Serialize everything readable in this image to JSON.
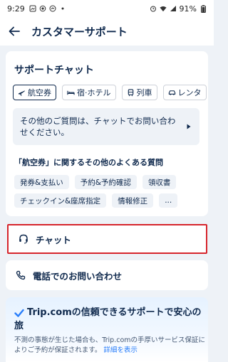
{
  "status_bar": {
    "time": "9:29",
    "battery": "91%"
  },
  "header": {
    "title": "カスタマーサポート"
  },
  "support_chat": {
    "title": "サポートチャット",
    "tabs": [
      {
        "label": "航空券",
        "icon": "plane-icon",
        "active": true
      },
      {
        "label": "宿·ホテル",
        "icon": "bed-icon",
        "active": false
      },
      {
        "label": "列車",
        "icon": "train-icon",
        "active": false
      },
      {
        "label": "レンタ",
        "icon": "car-icon",
        "active": false
      }
    ],
    "info_text": "その他のご質問は、チャットでお問い合わせください。",
    "faq_heading": "「航空券」に関するその他のよくある質問",
    "faq_chips": [
      [
        "発券&支払い",
        "予約&予約確認",
        "領収書"
      ],
      [
        "チェックイン&座席指定",
        "情報修正",
        "..."
      ]
    ]
  },
  "chat_row": {
    "label": "チャット",
    "icon": "headset-icon"
  },
  "phone_row": {
    "label": "電話でのお問い合わせ",
    "icon": "phone-icon"
  },
  "trust": {
    "title": "Trip.comの信頼できるサポートで安心の旅",
    "body": "不測の事態が生じた場合も、Trip.comの手厚いサービス保証によりご予約が保証されます。",
    "link": "詳細を表示"
  },
  "colors": {
    "brand_blue": "#287dfa",
    "navy": "#0f294d",
    "highlight_red": "#d6252c"
  }
}
